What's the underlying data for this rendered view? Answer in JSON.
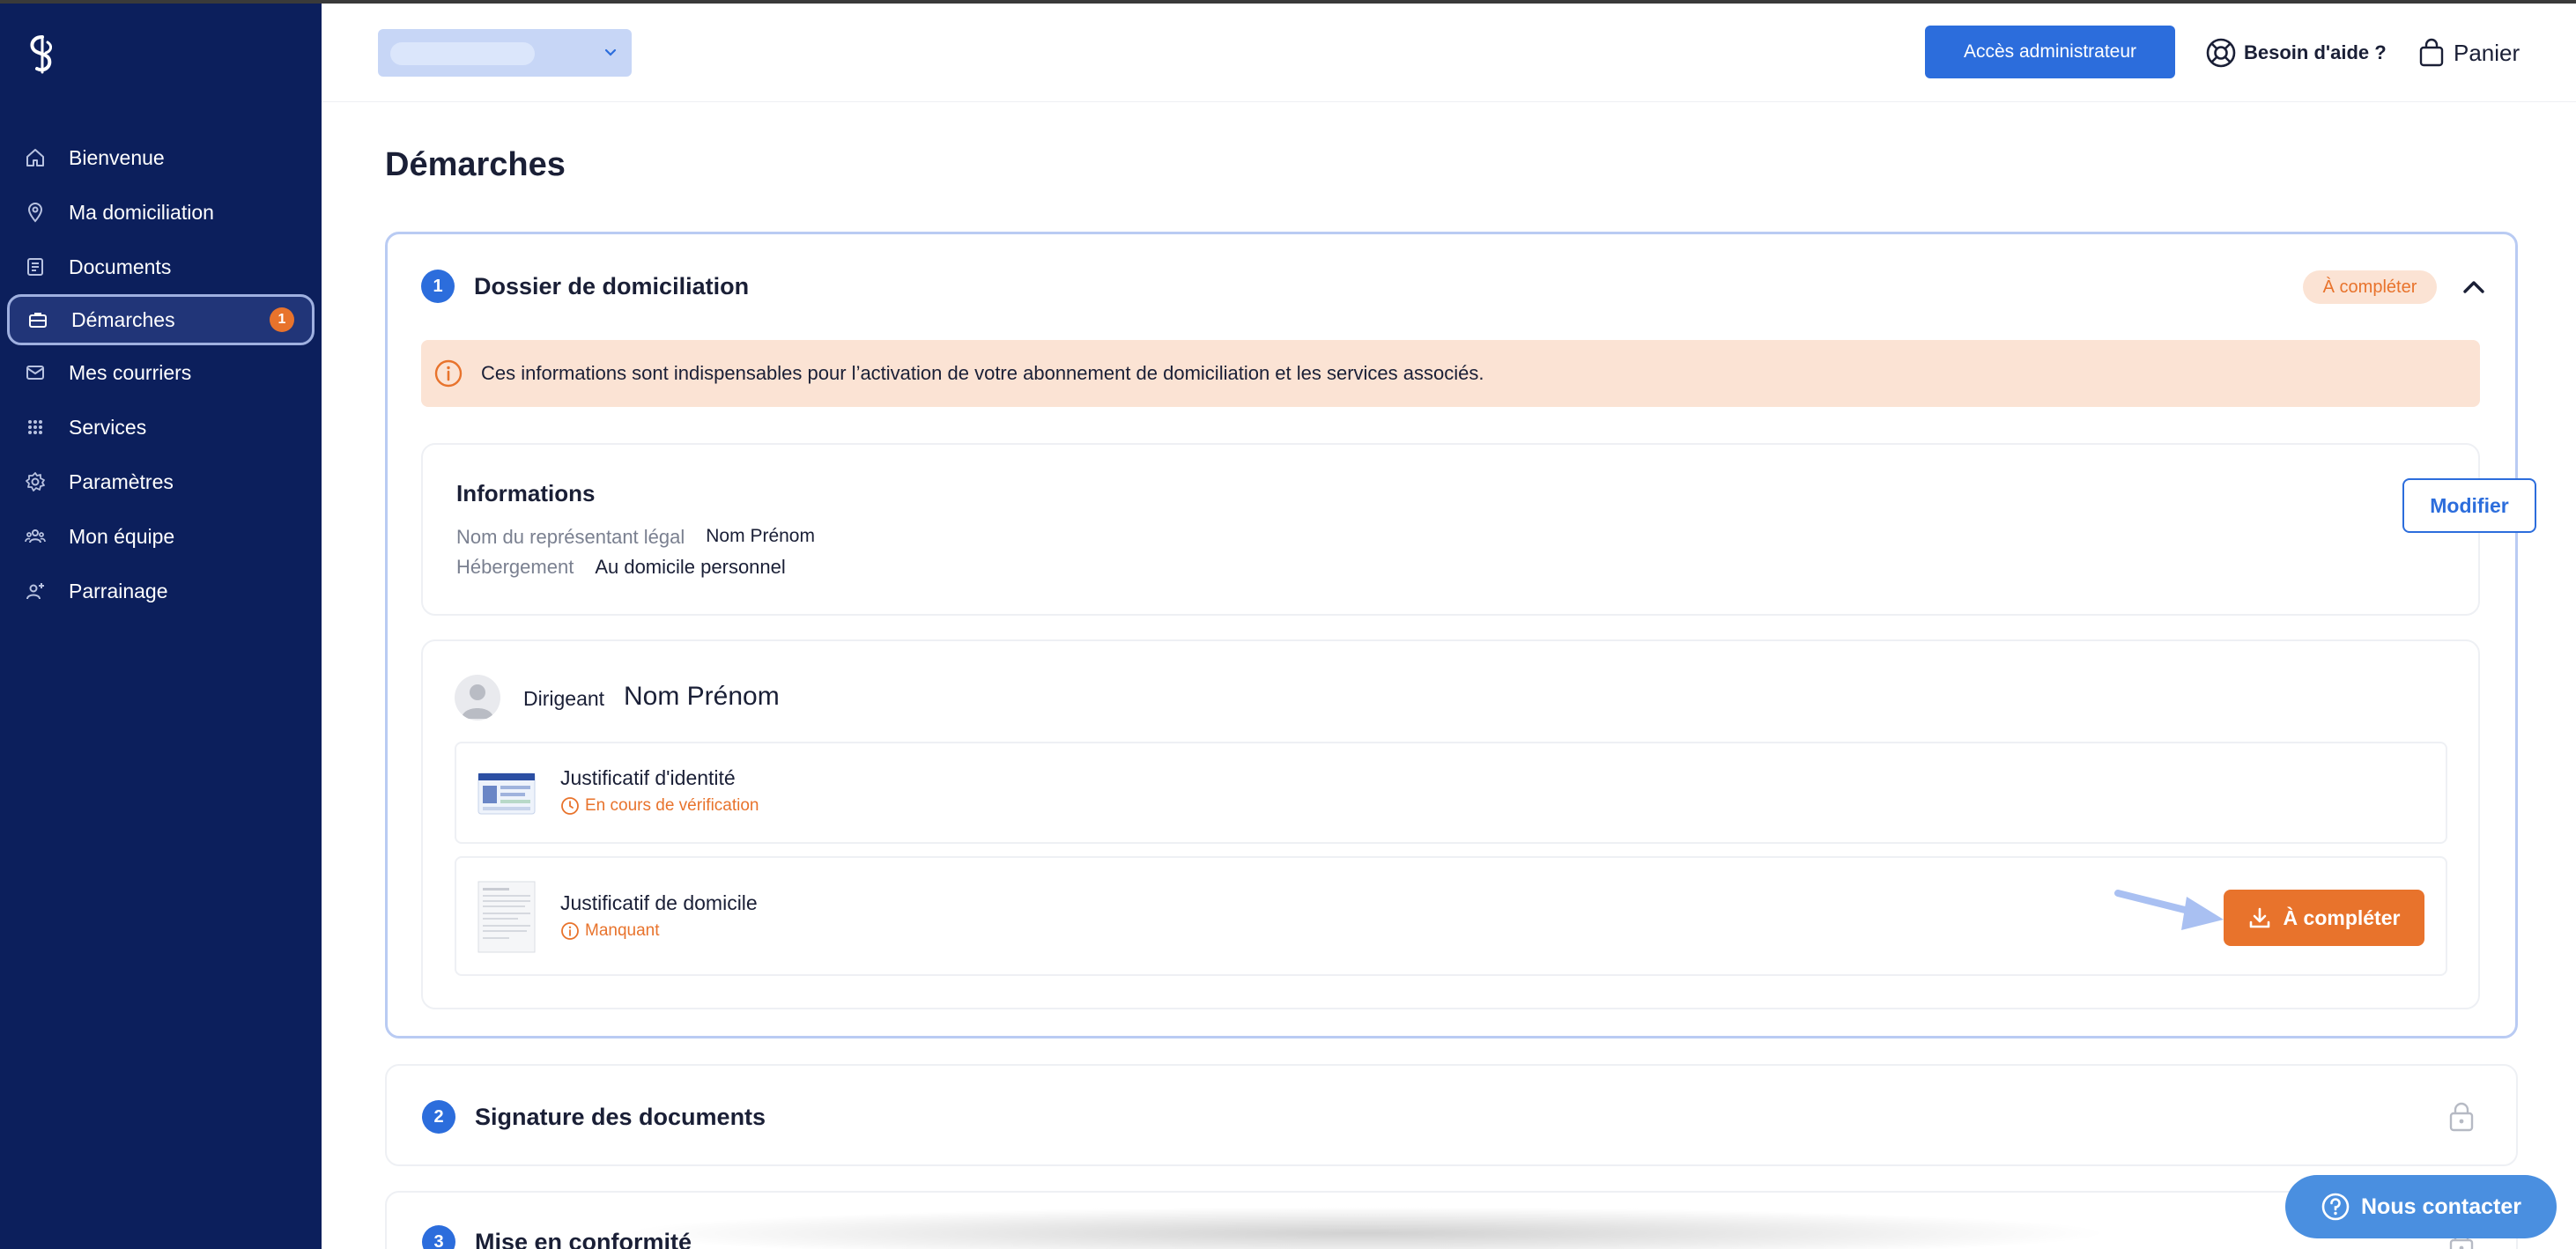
{
  "sidebar": {
    "items": [
      {
        "label": "Bienvenue",
        "icon": "home-icon"
      },
      {
        "label": "Ma domiciliation",
        "icon": "location-pin-icon"
      },
      {
        "label": "Documents",
        "icon": "document-icon"
      },
      {
        "label": "Démarches",
        "icon": "briefcase-icon",
        "badge": "1",
        "active": true
      },
      {
        "label": "Mes courriers",
        "icon": "mail-icon"
      },
      {
        "label": "Services",
        "icon": "grid-icon"
      },
      {
        "label": "Paramètres",
        "icon": "gear-icon"
      },
      {
        "label": "Mon équipe",
        "icon": "team-icon"
      },
      {
        "label": "Parrainage",
        "icon": "referral-icon"
      }
    ]
  },
  "header": {
    "admin_button": "Accès administrateur",
    "help_label": "Besoin d'aide ?",
    "cart_label": "Panier"
  },
  "main": {
    "page_title": "Démarches",
    "step1": {
      "number": "1",
      "title": "Dossier de domiciliation",
      "status": "À compléter",
      "alert": "Ces informations sont indispensables pour l’activation de votre abonnement de domiciliation et les services associés.",
      "info": {
        "title": "Informations",
        "rows": [
          {
            "label": "Nom du représentant légal",
            "value": "Nom Prénom"
          },
          {
            "label": "Hébergement",
            "value": "Au domicile personnel"
          }
        ],
        "modify_button": "Modifier"
      },
      "director": {
        "label": "Dirigeant",
        "name": "Nom Prénom",
        "documents": [
          {
            "title": "Justificatif d'identité",
            "status": "En cours de vérification"
          },
          {
            "title": "Justificatif de domicile",
            "status": "Manquant",
            "action": "À compléter"
          }
        ]
      }
    },
    "step2": {
      "number": "2",
      "title": "Signature des documents"
    },
    "step3": {
      "number": "3",
      "title": "Mise en conformité"
    }
  },
  "contact_button": "Nous contacter",
  "colors": {
    "sidebar_bg": "#0c1f5c",
    "primary": "#2c6ddc",
    "accent_orange": "#e8732c",
    "alert_bg": "#fbe3d4"
  }
}
